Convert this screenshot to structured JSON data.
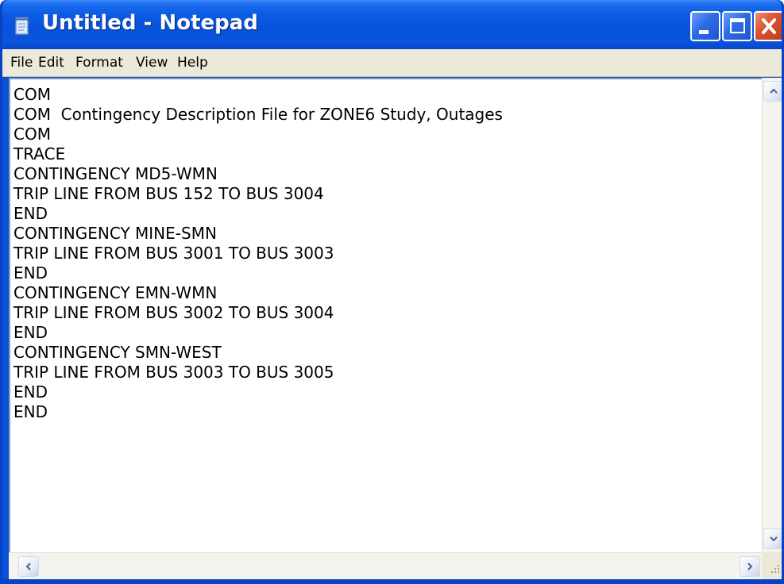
{
  "window": {
    "title": "Untitled - Notepad"
  },
  "menu": {
    "items": [
      "File",
      "Edit",
      "Format",
      "View",
      "Help"
    ]
  },
  "editor": {
    "lines": [
      "COM",
      "COM  Contingency Description File for ZONE6 Study, Outages",
      "COM",
      "TRACE",
      "CONTINGENCY MD5-WMN",
      "TRIP LINE FROM BUS 152 TO BUS 3004",
      "END",
      "CONTINGENCY MINE-SMN",
      "TRIP LINE FROM BUS 3001 TO BUS 3003",
      "END",
      "CONTINGENCY EMN-WMN",
      "TRIP LINE FROM BUS 3002 TO BUS 3004",
      "END",
      "CONTINGENCY SMN-WEST",
      "TRIP LINE FROM BUS 3003 TO BUS 3005",
      "END",
      "END"
    ]
  },
  "icons": {
    "app": "notepad-icon",
    "minimize": "minimize-icon",
    "maximize": "maximize-icon",
    "close": "close-icon",
    "scroll_up": "arrow-up-icon",
    "scroll_down": "arrow-down-icon",
    "scroll_left": "arrow-left-icon",
    "scroll_right": "arrow-right-icon",
    "size_grip": "size-grip-icon"
  },
  "colors": {
    "titlebar": "#0A55DE",
    "close_button": "#D9502E",
    "menubar": "#ECE9D8",
    "editor_background": "#FFFFFF"
  }
}
